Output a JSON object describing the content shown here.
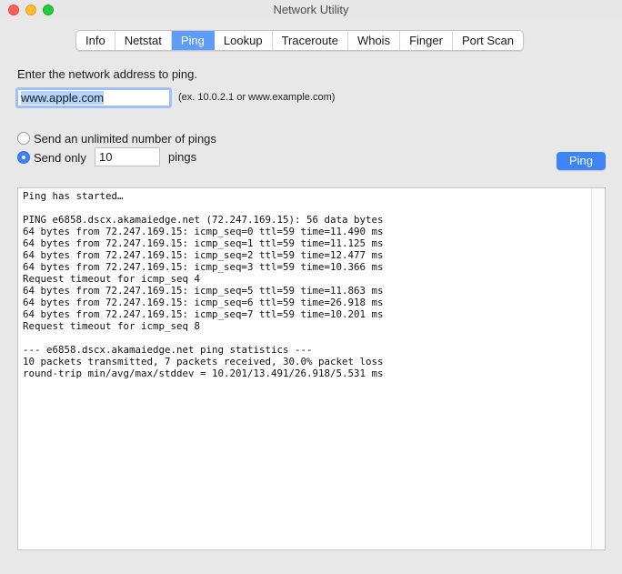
{
  "window": {
    "title": "Network Utility"
  },
  "tabs": [
    {
      "label": "Info"
    },
    {
      "label": "Netstat"
    },
    {
      "label": "Ping",
      "active": true
    },
    {
      "label": "Lookup"
    },
    {
      "label": "Traceroute"
    },
    {
      "label": "Whois"
    },
    {
      "label": "Finger"
    },
    {
      "label": "Port Scan"
    }
  ],
  "ping": {
    "prompt": "Enter the network address to ping.",
    "address_value": "www.apple.com",
    "example": "(ex. 10.0.2.1 or www.example.com)",
    "option_unlimited": "Send an unlimited number of pings",
    "option_sendonly": "Send only",
    "count_value": "10",
    "pings_label": "pings",
    "button_label": "Ping",
    "selected_option": "send-only"
  },
  "output": {
    "lines": [
      "Ping has started…",
      "",
      "PING e6858.dscx.akamaiedge.net (72.247.169.15): 56 data bytes",
      "64 bytes from 72.247.169.15: icmp_seq=0 ttl=59 time=11.490 ms",
      "64 bytes from 72.247.169.15: icmp_seq=1 ttl=59 time=11.125 ms",
      "64 bytes from 72.247.169.15: icmp_seq=2 ttl=59 time=12.477 ms",
      "64 bytes from 72.247.169.15: icmp_seq=3 ttl=59 time=10.366 ms",
      "Request timeout for icmp_seq 4",
      "64 bytes from 72.247.169.15: icmp_seq=5 ttl=59 time=11.863 ms",
      "64 bytes from 72.247.169.15: icmp_seq=6 ttl=59 time=26.918 ms",
      "64 bytes from 72.247.169.15: icmp_seq=7 ttl=59 time=10.201 ms",
      "Request timeout for icmp_seq 8",
      "",
      "--- e6858.dscx.akamaiedge.net ping statistics ---",
      "10 packets transmitted, 7 packets received, 30.0% packet loss",
      "round-trip min/avg/max/stddev = 10.201/13.491/26.918/5.531 ms"
    ]
  },
  "colors": {
    "accent": "#3d85f7",
    "tab_active": "#5e9cf6",
    "close": "#fe5f57",
    "minimize": "#febc2e",
    "maximize": "#28c840"
  }
}
